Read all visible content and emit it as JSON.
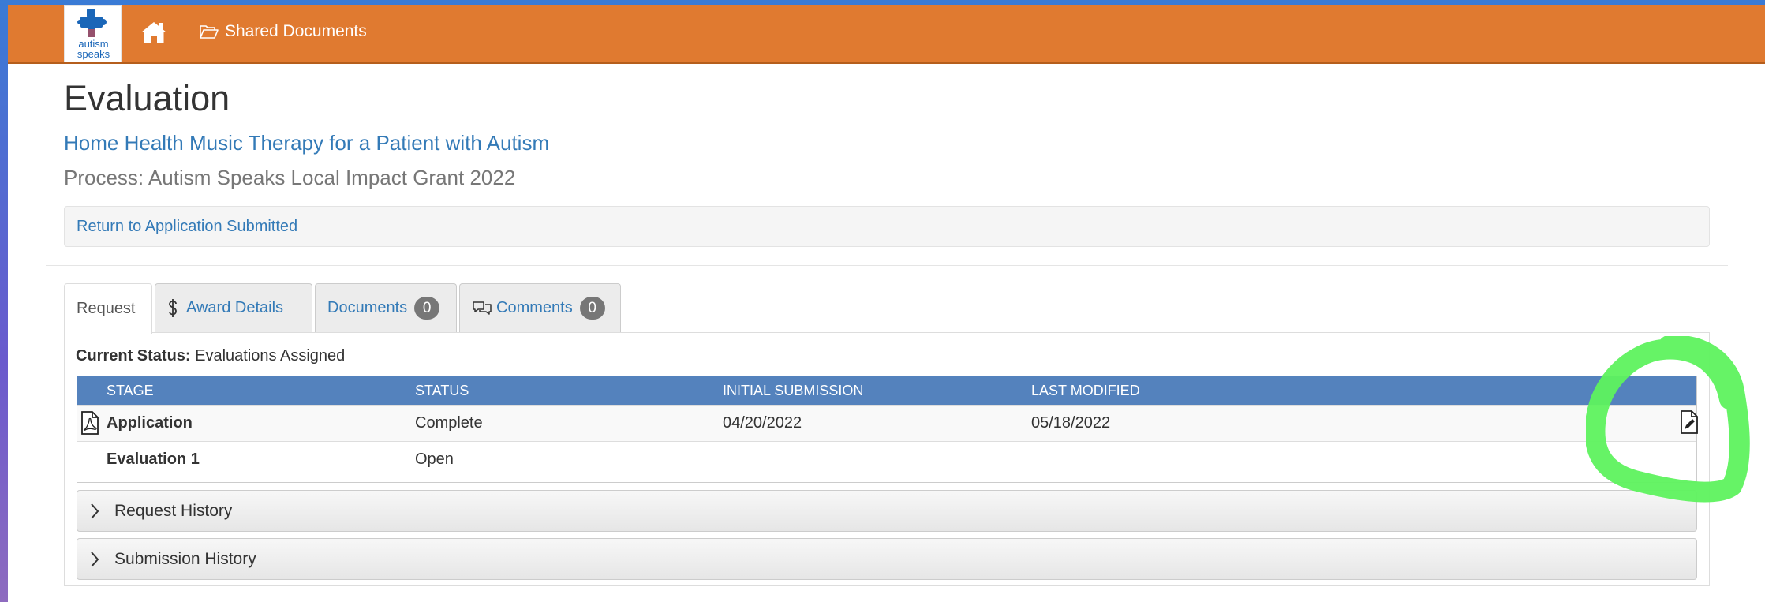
{
  "navbar": {
    "logo_line1": "autism",
    "logo_line2": "speaks",
    "shared_documents": "Shared Documents"
  },
  "header": {
    "title": "Evaluation",
    "project_link": "Home Health Music Therapy for a Patient with Autism",
    "process": "Process: Autism Speaks Local Impact Grant 2022",
    "return_link": "Return to Application Submitted"
  },
  "tabs": [
    {
      "label": "Request",
      "active": true
    },
    {
      "label": "Award Details",
      "icon": "dollar-icon"
    },
    {
      "label": "Documents",
      "badge": "0"
    },
    {
      "label": "Comments",
      "icon": "comments-icon",
      "badge": "0"
    }
  ],
  "status": {
    "label": "Current Status:",
    "value": "Evaluations Assigned"
  },
  "table": {
    "headers": [
      "STAGE",
      "STATUS",
      "INITIAL SUBMISSION",
      "LAST MODIFIED"
    ],
    "rows": [
      {
        "stage": "Application",
        "status": "Complete",
        "initial": "04/20/2022",
        "modified": "05/18/2022",
        "icon": "pdf-icon",
        "action_icon": "edit-document-icon"
      },
      {
        "stage": "Evaluation 1",
        "status": "Open",
        "initial": "",
        "modified": ""
      }
    ]
  },
  "accordions": [
    "Request History",
    "Submission History"
  ],
  "colors": {
    "navbar": "#e07a30",
    "link": "#337ab7",
    "table_header": "#5482bd",
    "highlight_annotation": "#5ef25e"
  }
}
